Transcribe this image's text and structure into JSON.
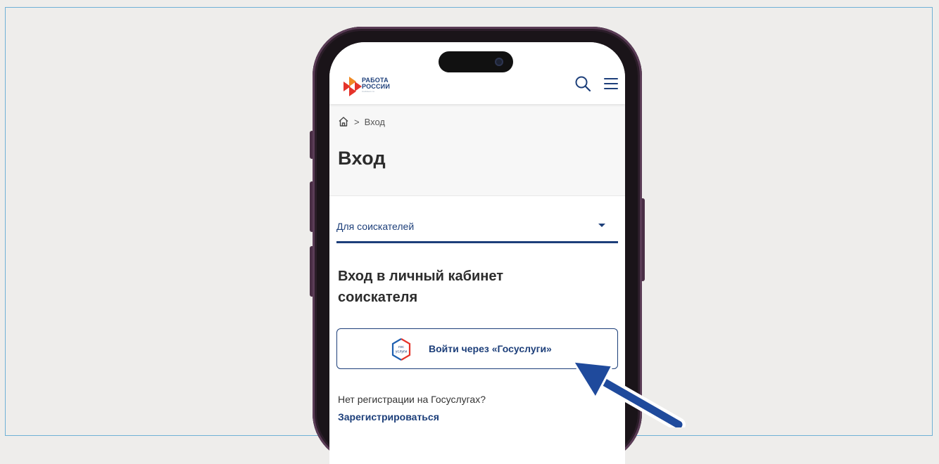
{
  "header": {
    "logo_line1": "РАБОТА",
    "logo_line2": "РОССИИ",
    "logo_sub": "trudvsem.ru",
    "search_icon": "search-icon",
    "menu_icon": "hamburger-menu-icon"
  },
  "breadcrumb": {
    "home_icon": "home-icon",
    "separator": ">",
    "current": "Вход"
  },
  "page": {
    "title": "Вход"
  },
  "role_select": {
    "value": "Для соискателей"
  },
  "login_section": {
    "title": "Вход в личный кабинет соискателя",
    "gosuslugi_button": "Войти через «Госуслуги»",
    "gosuslugi_logo_line1": "гос",
    "gosuslugi_logo_line2": "услуги",
    "no_registration_text": "Нет регистрации на Госуслугах?",
    "register_link": "Зарегистрироваться"
  },
  "colors": {
    "brand_blue": "#1d3f7a",
    "logo_red": "#e5332a",
    "logo_orange": "#f08a24",
    "arrow_blue": "#1f4a9c"
  }
}
